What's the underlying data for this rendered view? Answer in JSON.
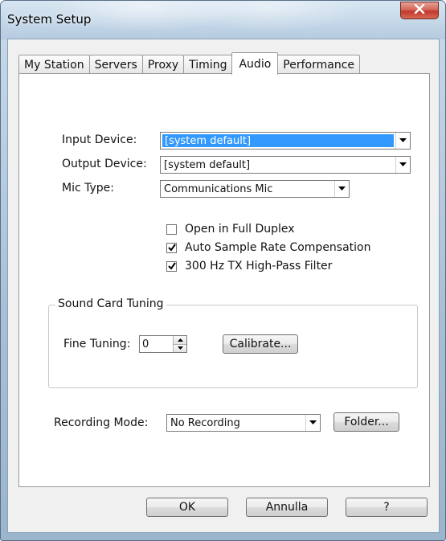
{
  "window": {
    "title": "System Setup",
    "close_label": "✕"
  },
  "tabs": [
    {
      "label": "My Station"
    },
    {
      "label": "Servers"
    },
    {
      "label": "Proxy"
    },
    {
      "label": "Timing"
    },
    {
      "label": "Audio",
      "active": true
    },
    {
      "label": "Performance"
    }
  ],
  "audio": {
    "input_device": {
      "label": "Input Device:",
      "value": "[system default]"
    },
    "output_device": {
      "label": "Output Device:",
      "value": "[system default]"
    },
    "mic_type": {
      "label": "Mic Type:",
      "value": "Communications Mic"
    },
    "checkboxes": [
      {
        "label": "Open in Full Duplex",
        "checked": false
      },
      {
        "label": "Auto Sample Rate Compensation",
        "checked": true
      },
      {
        "label": "300 Hz TX High-Pass Filter",
        "checked": true
      }
    ],
    "sound_card_tuning": {
      "title": "Sound Card Tuning",
      "fine_tuning_label": "Fine Tuning:",
      "fine_tuning_value": "0",
      "calibrate_label": "Calibrate..."
    },
    "recording_mode": {
      "label": "Recording Mode:",
      "value": "No Recording"
    },
    "folder_label": "Folder..."
  },
  "footer": {
    "ok_label": "OK",
    "cancel_label": "Annulla",
    "help_label": "?"
  }
}
